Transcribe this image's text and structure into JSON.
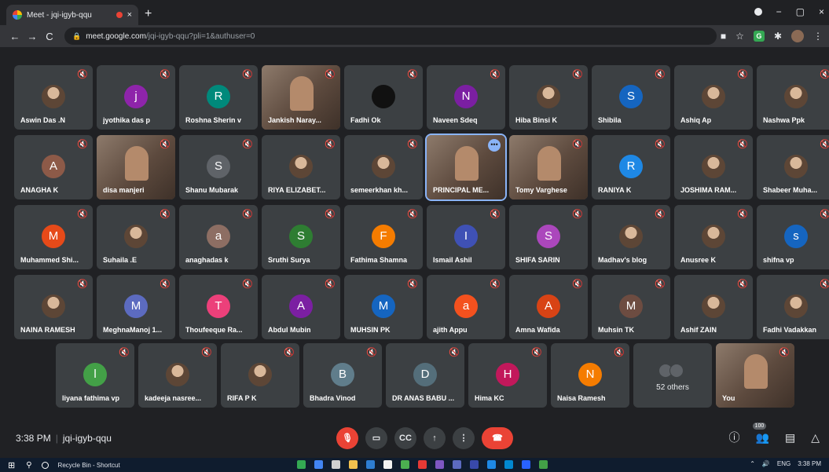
{
  "browser": {
    "tab_title": "Meet - jqi-igyb-qqu",
    "tab_close": "×",
    "new_tab": "+",
    "url_host": "meet.google.com",
    "url_path": "/jqi-igyb-qqu?pli=1&authuser=0",
    "window_min": "−",
    "window_max": "▢",
    "window_close": "×"
  },
  "participants": [
    {
      "name": "Aswin Das .N",
      "avatar": "",
      "color": "photo",
      "video": false
    },
    {
      "name": "jyothika das p",
      "avatar": "j",
      "color": "#8e24aa",
      "video": false
    },
    {
      "name": "Roshna Sherin v",
      "avatar": "R",
      "color": "#00897b",
      "video": false
    },
    {
      "name": "Jankish Naray...",
      "avatar": "",
      "color": "",
      "video": true
    },
    {
      "name": "Fadhi Ok",
      "avatar": "",
      "color": "#111111",
      "video": false
    },
    {
      "name": "Naveen Sdeq",
      "avatar": "N",
      "color": "#7b1fa2",
      "video": false
    },
    {
      "name": "Hiba Binsi K",
      "avatar": "",
      "color": "photo",
      "video": false
    },
    {
      "name": "Shibila",
      "avatar": "S",
      "color": "#1565c0",
      "video": false
    },
    {
      "name": "Ashiq Ap",
      "avatar": "",
      "color": "photo",
      "video": false
    },
    {
      "name": "Nashwa Ppk",
      "avatar": "",
      "color": "photo",
      "video": false
    },
    {
      "name": "ANAGHA K",
      "avatar": "A",
      "color": "#8d5a48",
      "video": false
    },
    {
      "name": "disa manjeri",
      "avatar": "",
      "color": "",
      "video": true
    },
    {
      "name": "Shanu Mubarak",
      "avatar": "S",
      "color": "#5f6368",
      "video": false
    },
    {
      "name": "RIYA ELIZABET...",
      "avatar": "",
      "color": "photo",
      "video": false
    },
    {
      "name": "semeerkhan kh...",
      "avatar": "",
      "color": "photo",
      "video": false
    },
    {
      "name": "PRINCIPAL ME...",
      "avatar": "",
      "color": "",
      "video": true
    },
    {
      "name": "Tomy Varghese",
      "avatar": "",
      "color": "",
      "video": true
    },
    {
      "name": "RANIYA K",
      "avatar": "R",
      "color": "#1e88e5",
      "video": false
    },
    {
      "name": "JOSHIMA RAM...",
      "avatar": "",
      "color": "photo",
      "video": false
    },
    {
      "name": "Shabeer Muha...",
      "avatar": "",
      "color": "photo",
      "video": false
    },
    {
      "name": "Muhammed Shi...",
      "avatar": "M",
      "color": "#e64a19",
      "video": false
    },
    {
      "name": "Suhaila .E",
      "avatar": "",
      "color": "photo",
      "video": false
    },
    {
      "name": "anaghadas k",
      "avatar": "a",
      "color": "#8d6e63",
      "video": false
    },
    {
      "name": "Sruthi Surya",
      "avatar": "S",
      "color": "#2e7d32",
      "video": false
    },
    {
      "name": "Fathima Shamna",
      "avatar": "F",
      "color": "#f57c00",
      "video": false
    },
    {
      "name": "Ismail Ashil",
      "avatar": "I",
      "color": "#3f51b5",
      "video": false
    },
    {
      "name": "SHIFA SARIN",
      "avatar": "S",
      "color": "#ab47bc",
      "video": false
    },
    {
      "name": "Madhav's blog",
      "avatar": "",
      "color": "photo",
      "video": false
    },
    {
      "name": "Anusree K",
      "avatar": "",
      "color": "photo",
      "video": false
    },
    {
      "name": "shifna vp",
      "avatar": "s",
      "color": "#1565c0",
      "video": false
    },
    {
      "name": "NAINA RAMESH",
      "avatar": "",
      "color": "photo",
      "video": false
    },
    {
      "name": "MeghnaManoj 1...",
      "avatar": "M",
      "color": "#5c6bc0",
      "video": false
    },
    {
      "name": "Thoufeeque Ra...",
      "avatar": "T",
      "color": "#ec407a",
      "video": false
    },
    {
      "name": "Abdul Mubin",
      "avatar": "A",
      "color": "#7b1fa2",
      "video": false
    },
    {
      "name": "MUHSIN PK",
      "avatar": "M",
      "color": "#1565c0",
      "video": false
    },
    {
      "name": "ajith Appu",
      "avatar": "a",
      "color": "#f4511e",
      "video": false
    },
    {
      "name": "Amna Wafida",
      "avatar": "A",
      "color": "#d84315",
      "video": false
    },
    {
      "name": "Muhsin TK",
      "avatar": "M",
      "color": "#6d4c41",
      "video": false
    },
    {
      "name": "Ashif ZAIN",
      "avatar": "",
      "color": "photo",
      "video": false
    },
    {
      "name": "Fadhi Vadakkan",
      "avatar": "",
      "color": "photo",
      "video": false
    },
    {
      "name": "liyana fathima vp",
      "avatar": "l",
      "color": "#43a047",
      "video": false
    },
    {
      "name": "kadeeja nasree...",
      "avatar": "",
      "color": "photo",
      "video": false
    },
    {
      "name": "RIFA P K",
      "avatar": "",
      "color": "photo",
      "video": false
    },
    {
      "name": "Bhadra Vinod",
      "avatar": "B",
      "color": "#607d8b",
      "video": false
    },
    {
      "name": "DR ANAS BABU ...",
      "avatar": "D",
      "color": "#546e7a",
      "video": false
    },
    {
      "name": "Hima KC",
      "avatar": "H",
      "color": "#c2185b",
      "video": false
    },
    {
      "name": "Naisa Ramesh",
      "avatar": "N",
      "color": "#f57c00",
      "video": false
    }
  ],
  "others": {
    "label": "52 others"
  },
  "self": {
    "label": "You"
  },
  "meeting": {
    "time": "3:38 PM",
    "code": "jqi-igyb-qqu",
    "people_count": "100"
  },
  "controls": {
    "cc": "CC",
    "present": "↑",
    "more": "⋮"
  },
  "taskbar": {
    "recycle": "Recycle Bin - Shortcut",
    "lang": "ENG",
    "time": "3:38 PM"
  }
}
